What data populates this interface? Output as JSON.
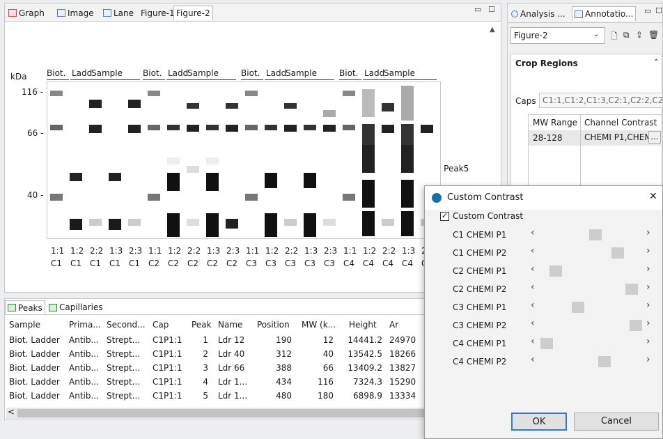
{
  "tabs": [
    {
      "label": "Graph"
    },
    {
      "label": "Image"
    },
    {
      "label": "Lane"
    },
    {
      "label": "Figure-1"
    },
    {
      "label": "Figure-2"
    }
  ],
  "graph": {
    "kda_label": "kDa",
    "group_headers": [
      {
        "biot": "Biot.",
        "ladd": "Ladd",
        "sample": "Sample"
      },
      {
        "biot": "Biot.",
        "ladd": "Ladd",
        "sample": "Sample"
      },
      {
        "biot": "Biot.",
        "ladd": "Ladd",
        "sample": "Sample"
      },
      {
        "biot": "Biot.",
        "ladd": "Ladd",
        "sample": "Sample"
      }
    ],
    "mw_ticks": [
      "116 -",
      "66 -",
      "40 -"
    ],
    "peak_label": "- Peak5",
    "lane_top": [
      "1:1",
      "1:2",
      "2:2",
      "1:3",
      "2:3",
      "1:1",
      "1:2",
      "2:2",
      "1:3",
      "2:3",
      "1:1",
      "1:2",
      "2:2",
      "1:3",
      "2:3",
      "1:1",
      "1:2",
      "2:2",
      "1:3",
      "2"
    ],
    "lane_bottom": [
      "C1",
      "C1",
      "C1",
      "C1",
      "C1",
      "C2",
      "C2",
      "C2",
      "C2",
      "C2",
      "C3",
      "C3",
      "C3",
      "C3",
      "C3",
      "C4",
      "C4",
      "C4",
      "C4",
      "C"
    ]
  },
  "bottom_tabs": {
    "peaks": "Peaks",
    "capillaries": "Capillaries"
  },
  "table": {
    "headers": [
      "Sample",
      "Prima...",
      "Second...",
      "Cap",
      "Peak",
      "Name",
      "Position",
      "MW (k...",
      "Height",
      "Ar"
    ],
    "rows": [
      [
        "Biot. Ladder",
        "Antib...",
        "Strept...",
        "C1P1:1",
        "1",
        "Ldr 12",
        "190",
        "12",
        "14441.2",
        "24970"
      ],
      [
        "Biot. Ladder",
        "Antib...",
        "Strept...",
        "C1P1:1",
        "2",
        "Ldr 40",
        "312",
        "40",
        "13542.5",
        "18266"
      ],
      [
        "Biot. Ladder",
        "Antib...",
        "Strept...",
        "C1P1:1",
        "3",
        "Ldr 66",
        "388",
        "66",
        "13409.2",
        "13827"
      ],
      [
        "Biot. Ladder",
        "Antib...",
        "Strept...",
        "C1P1:1",
        "4",
        "Ldr 1...",
        "434",
        "116",
        "7324.3",
        "15290"
      ],
      [
        "Biot. Ladder",
        "Antib...",
        "Strept...",
        "C1P1:1",
        "5",
        "Ldr 1...",
        "480",
        "180",
        "6898.9",
        "13334"
      ]
    ]
  },
  "right_panel": {
    "tab_analysis": "Analysis ...",
    "tab_annotation": "Annotatio...",
    "figure_select": "Figure-2",
    "section_title": "Crop Regions",
    "caps_label": "Caps",
    "caps_value": "C1:1,C1:2,C1:3,C2:1,C2:2,C2:",
    "col_mw": "MW Range",
    "col_contrast": "Channel Contrast",
    "mw_value": "28-128",
    "contrast_value": "CHEMI P1,CHEM",
    "ellipsis": "..."
  },
  "dialog": {
    "title": "Custom Contrast",
    "close": "✕",
    "checkbox_label": "Custom Contrast",
    "checked": true,
    "rows": [
      {
        "label": "C1 CHEMI P1",
        "level": 0.55
      },
      {
        "label": "C1 CHEMI P2",
        "level": 0.8
      },
      {
        "label": "C2 CHEMI P1",
        "level": 0.1
      },
      {
        "label": "C2 CHEMI P2",
        "level": 0.95
      },
      {
        "label": "C3 CHEMI P1",
        "level": 0.35
      },
      {
        "label": "C3 CHEMI P2",
        "level": 1.0
      },
      {
        "label": "C4 CHEMI P1",
        "level": 0.0
      },
      {
        "label": "C4 CHEMI P2",
        "level": 0.65
      }
    ],
    "ok": "OK",
    "cancel": "Cancel"
  }
}
